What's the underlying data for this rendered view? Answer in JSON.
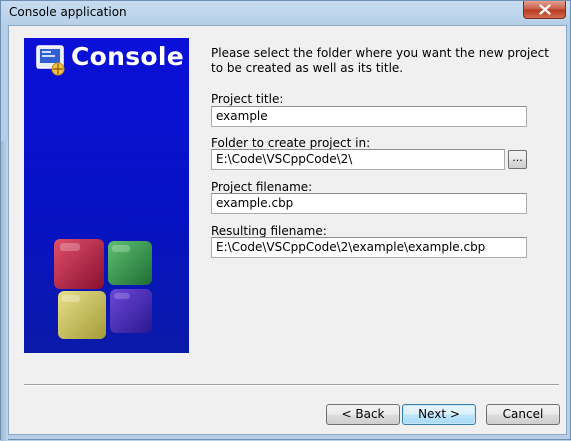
{
  "window": {
    "title": "Console application"
  },
  "banner": {
    "title": "Console"
  },
  "intro": "Please select the folder where you want the new project to be created as well as its title.",
  "fields": {
    "project_title": {
      "label": "Project title:",
      "value": "example"
    },
    "folder": {
      "label": "Folder to create project in:",
      "value": "E:\\Code\\VSCppCode\\2\\",
      "browse_label": "..."
    },
    "project_filename": {
      "label": "Project filename:",
      "value": "example.cbp"
    },
    "resulting_filename": {
      "label": "Resulting filename:",
      "value": "E:\\Code\\VSCppCode\\2\\example\\example.cbp"
    }
  },
  "buttons": {
    "back": "< Back",
    "next": "Next >",
    "cancel": "Cancel"
  },
  "colors": {
    "banner_blue": "#0a10d8",
    "default_button_border": "#3c7fb1"
  }
}
